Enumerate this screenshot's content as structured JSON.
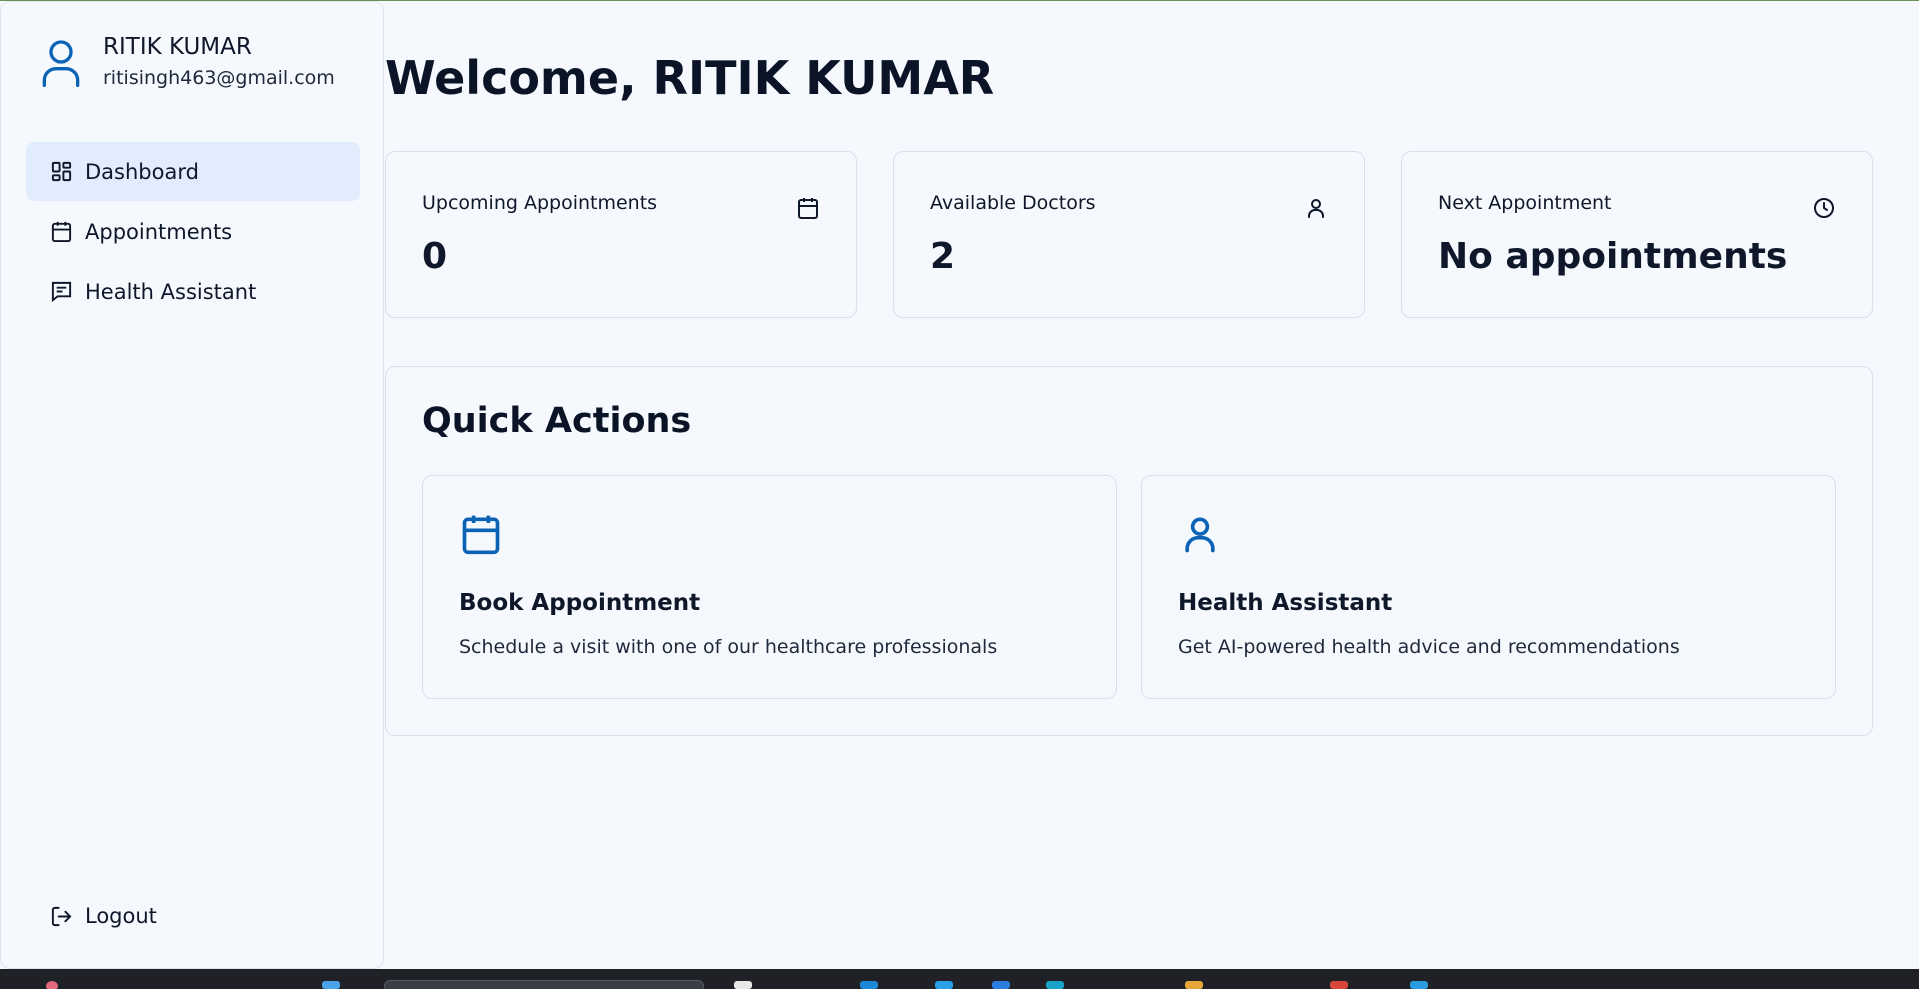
{
  "user": {
    "name": "RITIK KUMAR",
    "email": "ritisingh463@gmail.com"
  },
  "sidebar": {
    "items": [
      {
        "label": "Dashboard",
        "icon": "dashboard-icon",
        "active": true
      },
      {
        "label": "Appointments",
        "icon": "calendar-icon",
        "active": false
      },
      {
        "label": "Health Assistant",
        "icon": "chat-icon",
        "active": false
      }
    ],
    "logout_label": "Logout"
  },
  "main": {
    "welcome": "Welcome, RITIK KUMAR",
    "stats": [
      {
        "title": "Upcoming Appointments",
        "value": "0",
        "icon": "calendar-icon"
      },
      {
        "title": "Available Doctors",
        "value": "2",
        "icon": "user-icon"
      },
      {
        "title": "Next Appointment",
        "value": "No appointments",
        "icon": "clock-icon"
      }
    ],
    "quick_actions": {
      "title": "Quick Actions",
      "cards": [
        {
          "title": "Book Appointment",
          "desc": "Schedule a visit with one of our healthcare professionals",
          "icon": "calendar-icon"
        },
        {
          "title": "Health Assistant",
          "desc": "Get AI-powered health advice and recommendations",
          "icon": "user-icon"
        }
      ]
    }
  },
  "colors": {
    "accent": "#0b63b5",
    "background": "#f5f8fd",
    "active_nav": "#e1ecfc",
    "border": "#d3e2ee"
  }
}
